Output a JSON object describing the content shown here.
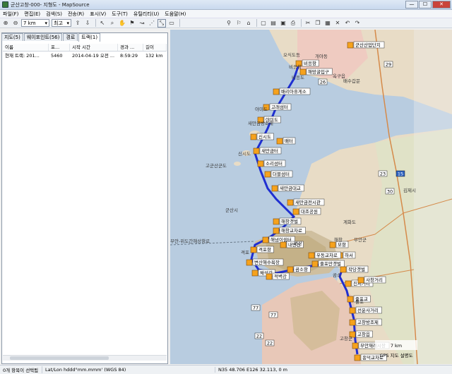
{
  "window": {
    "title": "군산고창-000- 지형도 - MapSource",
    "min": "—",
    "max": "☐",
    "close": "✕"
  },
  "menu": [
    "파일(F)",
    "편집(E)",
    "검색(S)",
    "전송(R)",
    "표시(V)",
    "도구(T)",
    "유틸리티(U)",
    "도움말(H)"
  ],
  "toolbar": {
    "scale_value": "7 km",
    "detail_value": "최고",
    "icons": [
      "zoom-in-icon",
      "zoom-out-icon",
      "scale-select",
      "detail-select",
      "send-icon",
      "receive-icon",
      "select-tool-icon",
      "zoom-tool-icon",
      "hand-tool-icon",
      "waypoint-tool-icon",
      "route-tool-icon",
      "track-tool-icon",
      "measure-tool-icon",
      "map-icon",
      "find-icon",
      "find-place-icon",
      "find-address-icon",
      "new-icon",
      "open-icon",
      "save-icon",
      "print-icon",
      "cut-icon",
      "copy-icon",
      "paste-icon",
      "delete-icon",
      "undo-icon",
      "redo-icon"
    ]
  },
  "tabs": [
    "지도(5)",
    "웨이포인트(56)",
    "경로",
    "트랙(1)"
  ],
  "grid": {
    "headers": [
      "이름",
      "포...",
      "시작 시간",
      "경과 ...",
      "길이"
    ],
    "rows": [
      [
        "현재 트랙: 201...",
        "5460",
        "2014-04-19 오전 ...",
        "8:59:29",
        "132 km"
      ]
    ]
  },
  "status": {
    "selection": "0개 항목이 선택됨",
    "coords_format": "Lat/Lon hddd°mm.mmm' (WGS 84)",
    "position": "N35 48.706 E126 32.113, 0 m"
  },
  "map": {
    "colors": {
      "sea": "#b8cce0",
      "land_tan": "#e8dcc6",
      "land_pink": "#f0c8c0",
      "land_green": "#cde6b0",
      "mountain": "#d9c8a8",
      "track": "#1f2fd1",
      "flag_fill": "#f6a21d",
      "route_road": "#d58a4a"
    },
    "labels": [
      {
        "text": "오식도동"
      },
      {
        "text": "비응항"
      },
      {
        "text": "비응도"
      },
      {
        "text": "군산시"
      },
      {
        "text": "새만금방조제"
      },
      {
        "text": "신시도"
      },
      {
        "text": "야미도"
      },
      {
        "text": "고군산군도"
      },
      {
        "text": "배수갑문"
      },
      {
        "text": "김제시"
      },
      {
        "text": "격포"
      },
      {
        "text": "변산"
      },
      {
        "text": "부안군"
      },
      {
        "text": "줄포"
      },
      {
        "text": "곰소"
      },
      {
        "text": "고창군"
      },
      {
        "text": "계화도"
      },
      {
        "text": "해창"
      },
      {
        "text": "개야동"
      },
      {
        "text": "옥구읍"
      },
      {
        "text": "부안-위도간해상항로"
      }
    ],
    "waypoints": [
      "비응항",
      "군산산업단지",
      "해망굴입구",
      "배리아휴게소",
      "고래섬터",
      "야미도",
      "신시도",
      "배터",
      "새만금터",
      "소리섬터",
      "더블섬터",
      "새만금대교",
      "새만금전시관",
      "대조공원",
      "해창갯벌",
      "해창교차로",
      "해넘이쉼터",
      "격포항",
      "변산해수욕장",
      "채석강",
      "적벽강",
      "곰소항",
      "줄포만갯벌",
      "하서",
      "작당갯벌",
      "진서거리",
      "줄포교",
      "선운사거리",
      "고창방조제",
      "고창읍",
      "부안재래시장",
      "내변산",
      "우동교차로",
      "모항",
      "사창거리",
      "흥덕교차로"
    ],
    "road_numbers": [
      "26",
      "29",
      "23",
      "30",
      "15",
      "77",
      "22",
      "77",
      "22"
    ],
    "scale_text": "7 km",
    "gps_label": "GPS 지도 설명도"
  }
}
